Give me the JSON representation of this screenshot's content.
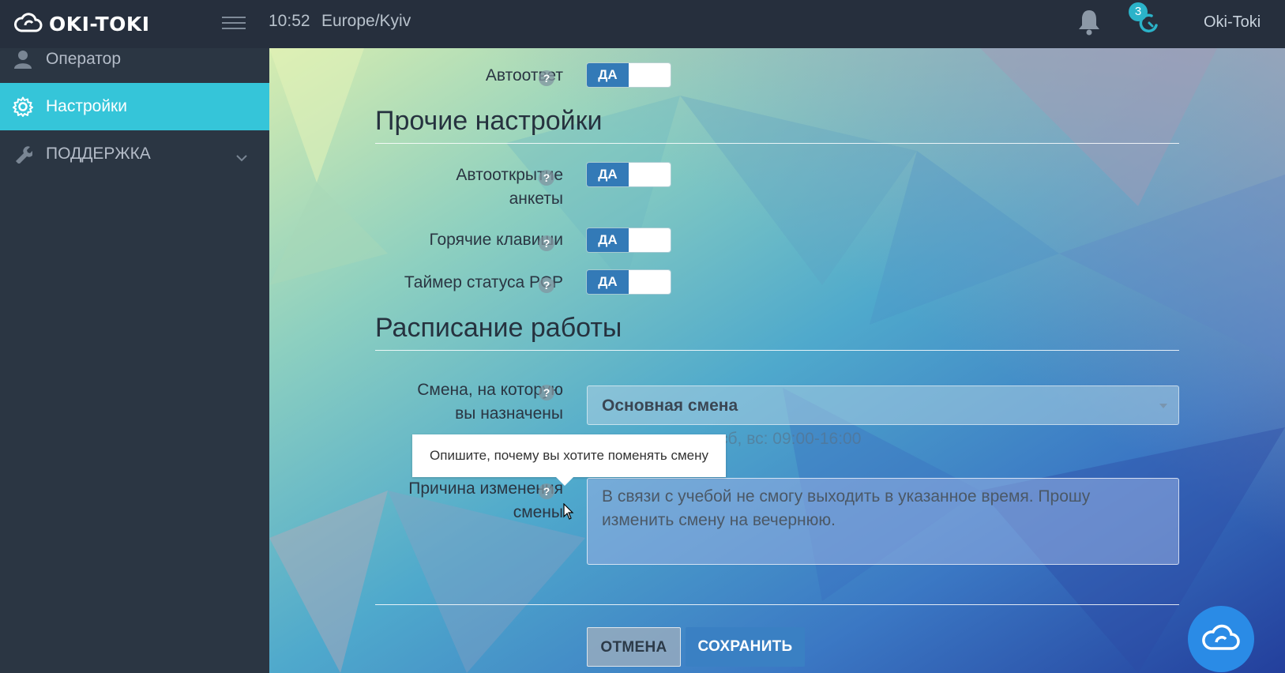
{
  "header": {
    "logo_text": "OKI-TOKI",
    "time": "10:52",
    "timezone": "Europe/Kyiv",
    "notification_badge": "3",
    "user_name": "Oki-Toki"
  },
  "sidebar": {
    "items": [
      {
        "label": "Оператор",
        "icon": "user-icon",
        "active": false
      },
      {
        "label": "Настройки",
        "icon": "gear-icon",
        "active": true
      },
      {
        "label": "ПОДДЕРЖКА",
        "icon": "wrench-icon",
        "active": false
      }
    ]
  },
  "settings": {
    "autoreply": {
      "label": "Автоответ",
      "value": "ДА"
    },
    "other_section_title": "Прочие настройки",
    "autoopen": {
      "label_line1": "Автооткрытие",
      "label_line2": "анкеты",
      "value": "ДА"
    },
    "hotkeys": {
      "label": "Горячие клавиши",
      "value": "ДА"
    },
    "pcp_timer": {
      "label": "Таймер статуса РСР",
      "value": "ДА"
    }
  },
  "schedule": {
    "section_title": "Расписание работы",
    "shift_label_line1": "Смена, на которую",
    "shift_label_line2": "вы назначены",
    "shift_value": "Основная смена",
    "shift_hours": "сб, вс: 09:00-16:00",
    "tooltip": "Опишите, почему вы хотите поменять смену",
    "reason_label_line1": "Причина изменения",
    "reason_label_line2": "смены",
    "reason_text": "В связи с учебой не смогу выходить в указанное время. Прошу изменить смену на вечернюю."
  },
  "actions": {
    "cancel_label": "ОТМЕНА",
    "save_label": "СОХРАНИТЬ"
  },
  "colors": {
    "sidebar_bg": "#2b3643",
    "topbar_bg": "#262f3d",
    "active_item": "#35c5d9",
    "toggle_on": "#337ab7",
    "save_button": "#3a80c3",
    "chat_fab": "#2a8be6"
  }
}
